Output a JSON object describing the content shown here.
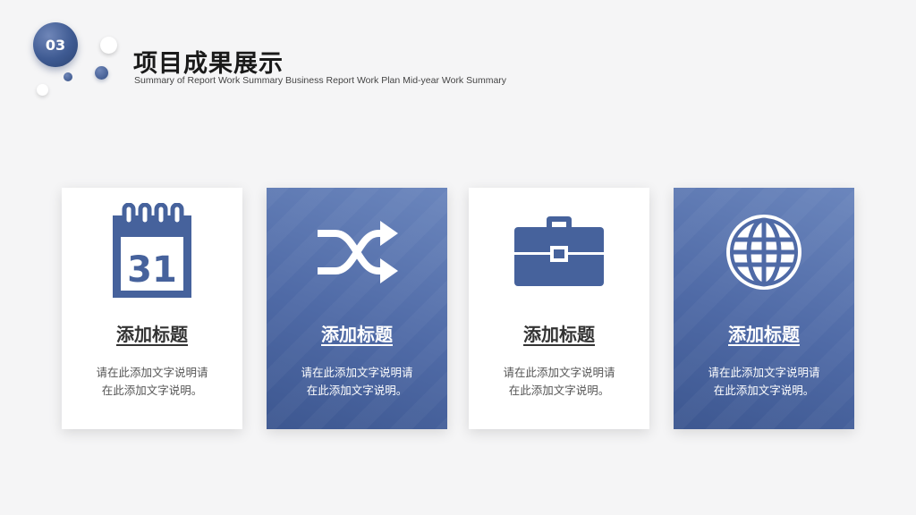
{
  "section": {
    "number": "03"
  },
  "header": {
    "title": "项目成果展示",
    "subtitle": "Summary of Report Work Summary Business Report Work Plan Mid-year Work Summary"
  },
  "cards": [
    {
      "icon": "calendar-icon",
      "icon_text": "31",
      "title": "添加标题",
      "desc_line1": "请在此添加文字说明请",
      "desc_line2": "在此添加文字说明。",
      "style": "light"
    },
    {
      "icon": "shuffle-icon",
      "title": "添加标题",
      "desc_line1": "请在此添加文字说明请",
      "desc_line2": "在此添加文字说明。",
      "style": "dark"
    },
    {
      "icon": "briefcase-icon",
      "title": "添加标题",
      "desc_line1": "请在此添加文字说明请",
      "desc_line2": "在此添加文字说明。",
      "style": "light"
    },
    {
      "icon": "globe-icon",
      "title": "添加标题",
      "desc_line1": "请在此添加文字说明请",
      "desc_line2": "在此添加文字说明。",
      "style": "dark"
    }
  ],
  "colors": {
    "accent": "#46629c",
    "accent_light": "#6b86bd",
    "background": "#f5f5f6"
  }
}
